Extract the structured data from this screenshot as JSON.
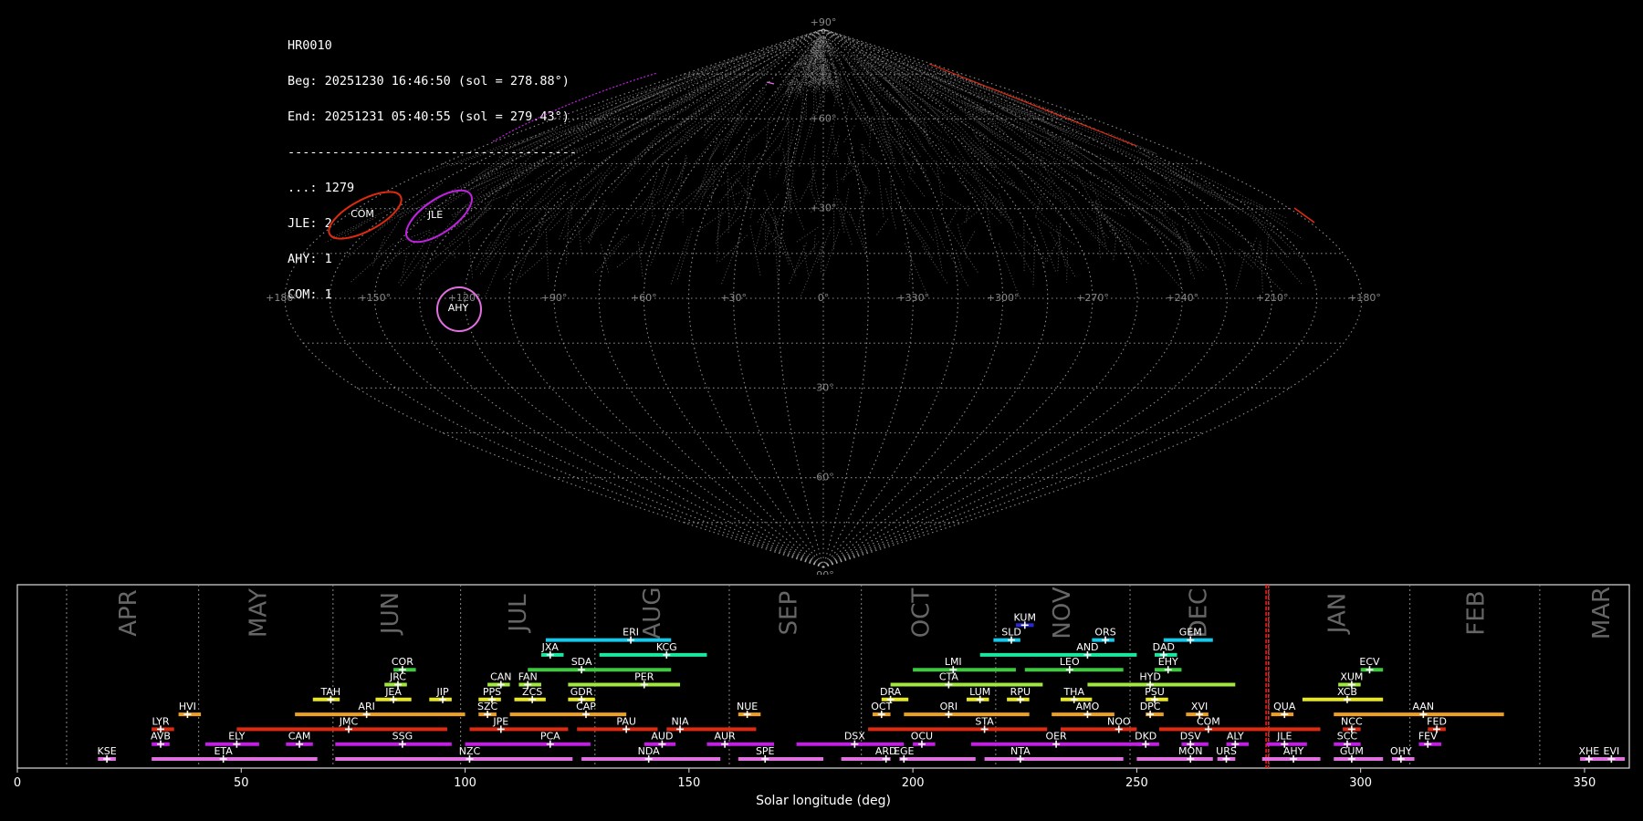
{
  "info_panel": {
    "station": "HR0010",
    "begin": "Beg: 20251230 16:46:50 (sol = 278.88°)",
    "end": "End: 20251231 05:40:55 (sol = 279.43°)",
    "separator": "---------------------------------------",
    "counts": [
      {
        "text": "...: 1279"
      },
      {
        "text": "JLE: 2"
      },
      {
        "text": "AHY: 1"
      },
      {
        "text": "COM: 1"
      }
    ]
  },
  "sky_map": {
    "projection": "sinusoidal",
    "ra_labels": [
      "+180°",
      "+150°",
      "+120°",
      "+90°",
      "+60°",
      "+30°",
      "0°",
      "+330°",
      "+300°",
      "+270°",
      "+240°",
      "+210°",
      "+180°"
    ],
    "dec_labels": [
      "+90°",
      "+60°",
      "+30°",
      "-30°",
      "-60°",
      "-90°"
    ],
    "radiants": [
      {
        "code": "COM",
        "color": "#e02a10"
      },
      {
        "code": "JLE",
        "color": "#c020e0"
      },
      {
        "code": "AHY",
        "color": "#e070e0"
      }
    ]
  },
  "chart_data": {
    "type": "timeline",
    "xlabel": "Solar longitude (deg)",
    "xlim": [
      0,
      360
    ],
    "x_ticks": [
      0,
      50,
      100,
      150,
      200,
      250,
      300,
      350
    ],
    "current_sol": [
      278.88,
      279.43
    ],
    "months": [
      {
        "name": "APR",
        "start": 11,
        "label_x": 25
      },
      {
        "name": "MAY",
        "start": 40.5,
        "label_x": 54
      },
      {
        "name": "JUN",
        "start": 70.5,
        "label_x": 83.5
      },
      {
        "name": "JUL",
        "start": 99,
        "label_x": 112
      },
      {
        "name": "AUG",
        "start": 129,
        "label_x": 142
      },
      {
        "name": "SEP",
        "start": 159,
        "label_x": 172.5
      },
      {
        "name": "OCT",
        "start": 188.5,
        "label_x": 202
      },
      {
        "name": "NOV",
        "start": 218.5,
        "label_x": 233.5
      },
      {
        "name": "DEC",
        "start": 248.5,
        "label_x": 264
      },
      {
        "name": "JAN",
        "start": 279.5,
        "label_x": 295
      },
      {
        "name": "FEB",
        "start": 311,
        "label_x": 326
      },
      {
        "name": "MAR",
        "start": 340,
        "label_x": 354
      }
    ],
    "showers": [
      {
        "code": "KUM",
        "start": 223,
        "end": 227,
        "peak": 225,
        "row": 9,
        "color": "#2828d8"
      },
      {
        "code": "ERI",
        "start": 118,
        "end": 146,
        "peak": 137,
        "row": 8,
        "color": "#18c8e8"
      },
      {
        "code": "SLD",
        "start": 218,
        "end": 224,
        "peak": 222,
        "row": 8,
        "color": "#18c8e8"
      },
      {
        "code": "ORS",
        "start": 240,
        "end": 245,
        "peak": 243,
        "row": 8,
        "color": "#18c8e8"
      },
      {
        "code": "GEM",
        "start": 256,
        "end": 267,
        "peak": 262,
        "row": 8,
        "color": "#18c8e8"
      },
      {
        "code": "JXA",
        "start": 117,
        "end": 122,
        "peak": 119,
        "row": 7,
        "color": "#18e8a0"
      },
      {
        "code": "KCG",
        "start": 130,
        "end": 154,
        "peak": 145,
        "row": 7,
        "color": "#18e8a0"
      },
      {
        "code": "AND",
        "start": 215,
        "end": 250,
        "peak": 239,
        "row": 7,
        "color": "#18e8a0"
      },
      {
        "code": "DAD",
        "start": 254,
        "end": 259,
        "peak": 256,
        "row": 7,
        "color": "#18e8a0"
      },
      {
        "code": "COR",
        "start": 84,
        "end": 89,
        "peak": 86,
        "row": 6,
        "color": "#40c840"
      },
      {
        "code": "SDA",
        "start": 114,
        "end": 146,
        "peak": 126,
        "row": 6,
        "color": "#40c840"
      },
      {
        "code": "LMI",
        "start": 200,
        "end": 223,
        "peak": 209,
        "row": 6,
        "color": "#40c840"
      },
      {
        "code": "LEO",
        "start": 225,
        "end": 247,
        "peak": 235,
        "row": 6,
        "color": "#40c840"
      },
      {
        "code": "EHY",
        "start": 254,
        "end": 260,
        "peak": 257,
        "row": 6,
        "color": "#40c840"
      },
      {
        "code": "ECV",
        "start": 300,
        "end": 305,
        "peak": 302,
        "row": 6,
        "color": "#40c840"
      },
      {
        "code": "JRC",
        "start": 82,
        "end": 87,
        "peak": 85,
        "row": 5,
        "color": "#a0e840"
      },
      {
        "code": "CAN",
        "start": 105,
        "end": 110,
        "peak": 108,
        "row": 5,
        "color": "#a0e840"
      },
      {
        "code": "FAN",
        "start": 112,
        "end": 117,
        "peak": 114,
        "row": 5,
        "color": "#a0e840"
      },
      {
        "code": "PER",
        "start": 123,
        "end": 148,
        "peak": 140,
        "row": 5,
        "color": "#a0e840"
      },
      {
        "code": "CTA",
        "start": 195,
        "end": 229,
        "peak": 208,
        "row": 5,
        "color": "#a0e840"
      },
      {
        "code": "HYD",
        "start": 239,
        "end": 272,
        "peak": 253,
        "row": 5,
        "color": "#a0e840"
      },
      {
        "code": "XUM",
        "start": 295,
        "end": 300,
        "peak": 298,
        "row": 5,
        "color": "#a0e840"
      },
      {
        "code": "TAH",
        "start": 66,
        "end": 72,
        "peak": 70,
        "row": 4,
        "color": "#e8e820"
      },
      {
        "code": "JEA",
        "start": 80,
        "end": 88,
        "peak": 84,
        "row": 4,
        "color": "#e8e820"
      },
      {
        "code": "JIP",
        "start": 92,
        "end": 97,
        "peak": 95,
        "row": 4,
        "color": "#e8e820"
      },
      {
        "code": "PPS",
        "start": 103,
        "end": 108,
        "peak": 106,
        "row": 4,
        "color": "#e8e820"
      },
      {
        "code": "ZCS",
        "start": 111,
        "end": 118,
        "peak": 115,
        "row": 4,
        "color": "#e8e820"
      },
      {
        "code": "GDR",
        "start": 123,
        "end": 129,
        "peak": 126,
        "row": 4,
        "color": "#e8e820"
      },
      {
        "code": "DRA",
        "start": 193,
        "end": 199,
        "peak": 195,
        "row": 4,
        "color": "#e8e820"
      },
      {
        "code": "LUM",
        "start": 212,
        "end": 217,
        "peak": 215,
        "row": 4,
        "color": "#e8e820"
      },
      {
        "code": "RPU",
        "start": 221,
        "end": 226,
        "peak": 224,
        "row": 4,
        "color": "#e8e820"
      },
      {
        "code": "THA",
        "start": 233,
        "end": 240,
        "peak": 236,
        "row": 4,
        "color": "#e8e820"
      },
      {
        "code": "PSU",
        "start": 252,
        "end": 257,
        "peak": 254,
        "row": 4,
        "color": "#e8e820"
      },
      {
        "code": "XCB",
        "start": 287,
        "end": 305,
        "peak": 297,
        "row": 4,
        "color": "#e8e820"
      },
      {
        "code": "HVI",
        "start": 36,
        "end": 41,
        "peak": 38,
        "row": 3,
        "color": "#f0a020"
      },
      {
        "code": "ARI",
        "start": 62,
        "end": 100,
        "peak": 78,
        "row": 3,
        "color": "#f0a020"
      },
      {
        "code": "SZC",
        "start": 103,
        "end": 107,
        "peak": 105,
        "row": 3,
        "color": "#f0a020"
      },
      {
        "code": "CAP",
        "start": 110,
        "end": 136,
        "peak": 127,
        "row": 3,
        "color": "#f0a020"
      },
      {
        "code": "NUE",
        "start": 161,
        "end": 166,
        "peak": 163,
        "row": 3,
        "color": "#f0a020"
      },
      {
        "code": "OCT",
        "start": 191,
        "end": 195,
        "peak": 193,
        "row": 3,
        "color": "#f0a020"
      },
      {
        "code": "ORI",
        "start": 198,
        "end": 226,
        "peak": 208,
        "row": 3,
        "color": "#f0a020"
      },
      {
        "code": "AMO",
        "start": 231,
        "end": 245,
        "peak": 239,
        "row": 3,
        "color": "#f0a020"
      },
      {
        "code": "DPC",
        "start": 252,
        "end": 256,
        "peak": 253,
        "row": 3,
        "color": "#f0a020"
      },
      {
        "code": "XVI",
        "start": 261,
        "end": 266,
        "peak": 264,
        "row": 3,
        "color": "#f0a020"
      },
      {
        "code": "QUA",
        "start": 280,
        "end": 285,
        "peak": 283,
        "row": 3,
        "color": "#f0a020"
      },
      {
        "code": "AAN",
        "start": 294,
        "end": 332,
        "peak": 314,
        "row": 3,
        "color": "#f0a020"
      },
      {
        "code": "LYR",
        "start": 30,
        "end": 35,
        "peak": 32,
        "row": 2,
        "color": "#e02a10"
      },
      {
        "code": "JMC",
        "start": 49,
        "end": 96,
        "peak": 74,
        "row": 2,
        "color": "#e02a10"
      },
      {
        "code": "JPE",
        "start": 101,
        "end": 123,
        "peak": 108,
        "row": 2,
        "color": "#e02a10"
      },
      {
        "code": "PAU",
        "start": 125,
        "end": 143,
        "peak": 136,
        "row": 2,
        "color": "#e02a10"
      },
      {
        "code": "NIA",
        "start": 145,
        "end": 165,
        "peak": 148,
        "row": 2,
        "color": "#e02a10"
      },
      {
        "code": "STA",
        "start": 190,
        "end": 230,
        "peak": 216,
        "row": 2,
        "color": "#e02a10"
      },
      {
        "code": "NOO",
        "start": 233,
        "end": 250,
        "peak": 246,
        "row": 2,
        "color": "#e02a10"
      },
      {
        "code": "COM",
        "start": 255,
        "end": 291,
        "peak": 266,
        "row": 2,
        "color": "#e02a10"
      },
      {
        "code": "NCC",
        "start": 296,
        "end": 300,
        "peak": 298,
        "row": 2,
        "color": "#e02a10"
      },
      {
        "code": "FED",
        "start": 315,
        "end": 319,
        "peak": 317,
        "row": 2,
        "color": "#e02a10"
      },
      {
        "code": "AVB",
        "start": 30,
        "end": 34,
        "peak": 32,
        "row": 1,
        "color": "#c020e0"
      },
      {
        "code": "ELY",
        "start": 42,
        "end": 54,
        "peak": 49,
        "row": 1,
        "color": "#c020e0"
      },
      {
        "code": "CAM",
        "start": 60,
        "end": 66,
        "peak": 63,
        "row": 1,
        "color": "#c020e0"
      },
      {
        "code": "SSG",
        "start": 71,
        "end": 97,
        "peak": 86,
        "row": 1,
        "color": "#c020e0"
      },
      {
        "code": "PCA",
        "start": 100,
        "end": 128,
        "peak": 119,
        "row": 1,
        "color": "#c020e0"
      },
      {
        "code": "AUD",
        "start": 140,
        "end": 147,
        "peak": 144,
        "row": 1,
        "color": "#c020e0"
      },
      {
        "code": "AUR",
        "start": 154,
        "end": 169,
        "peak": 158,
        "row": 1,
        "color": "#c020e0"
      },
      {
        "code": "DSX",
        "start": 174,
        "end": 198,
        "peak": 187,
        "row": 1,
        "color": "#c020e0"
      },
      {
        "code": "OCU",
        "start": 200,
        "end": 205,
        "peak": 202,
        "row": 1,
        "color": "#c020e0"
      },
      {
        "code": "OER",
        "start": 213,
        "end": 251,
        "peak": 232,
        "row": 1,
        "color": "#c020e0"
      },
      {
        "code": "DKD",
        "start": 250,
        "end": 255,
        "peak": 252,
        "row": 1,
        "color": "#c020e0"
      },
      {
        "code": "DSV",
        "start": 260,
        "end": 266,
        "peak": 262,
        "row": 1,
        "color": "#c020e0"
      },
      {
        "code": "ALY",
        "start": 270,
        "end": 275,
        "peak": 272,
        "row": 1,
        "color": "#c020e0"
      },
      {
        "code": "JLE",
        "start": 279,
        "end": 288,
        "peak": 283,
        "row": 1,
        "color": "#c020e0"
      },
      {
        "code": "SCC",
        "start": 294,
        "end": 300,
        "peak": 297,
        "row": 1,
        "color": "#c020e0"
      },
      {
        "code": "FEV",
        "start": 313,
        "end": 318,
        "peak": 315,
        "row": 1,
        "color": "#c020e0"
      },
      {
        "code": "KSE",
        "start": 18,
        "end": 22,
        "peak": 20,
        "row": 0,
        "color": "#e070e0"
      },
      {
        "code": "ETA",
        "start": 30,
        "end": 67,
        "peak": 46,
        "row": 0,
        "color": "#e070e0"
      },
      {
        "code": "NZC",
        "start": 71,
        "end": 124,
        "peak": 101,
        "row": 0,
        "color": "#e070e0"
      },
      {
        "code": "NDA",
        "start": 126,
        "end": 157,
        "peak": 141,
        "row": 0,
        "color": "#e070e0"
      },
      {
        "code": "SPE",
        "start": 161,
        "end": 180,
        "peak": 167,
        "row": 0,
        "color": "#e070e0"
      },
      {
        "code": "ARD",
        "start": 184,
        "end": 195,
        "peak": 194,
        "row": 0,
        "color": "#e070e0"
      },
      {
        "code": "EGE",
        "start": 197,
        "end": 214,
        "peak": 198,
        "row": 0,
        "color": "#e070e0"
      },
      {
        "code": "NTA",
        "start": 216,
        "end": 247,
        "peak": 224,
        "row": 0,
        "color": "#e070e0"
      },
      {
        "code": "MON",
        "start": 250,
        "end": 267,
        "peak": 262,
        "row": 0,
        "color": "#e070e0"
      },
      {
        "code": "URS",
        "start": 268,
        "end": 272,
        "peak": 270,
        "row": 0,
        "color": "#e070e0"
      },
      {
        "code": "AHY",
        "start": 278,
        "end": 291,
        "peak": 285,
        "row": 0,
        "color": "#e070e0"
      },
      {
        "code": "GUM",
        "start": 294,
        "end": 305,
        "peak": 298,
        "row": 0,
        "color": "#e070e0"
      },
      {
        "code": "OHY",
        "start": 307,
        "end": 312,
        "peak": 309,
        "row": 0,
        "color": "#e070e0"
      },
      {
        "code": "XHE",
        "start": 349,
        "end": 354,
        "peak": 351,
        "row": 0,
        "color": "#e070e0"
      },
      {
        "code": "EVI",
        "start": 354,
        "end": 359,
        "peak": 356,
        "row": 0,
        "color": "#e070e0"
      }
    ]
  }
}
